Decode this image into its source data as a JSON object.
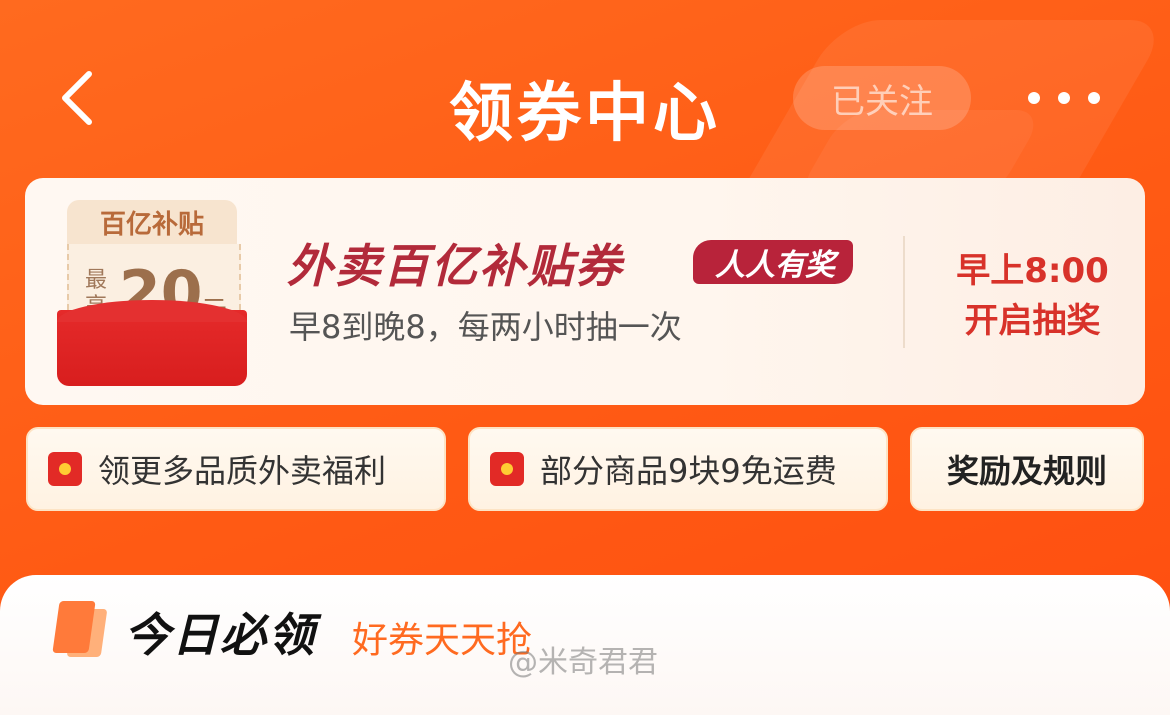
{
  "header": {
    "title": "领券中心",
    "follow_label": "已关注"
  },
  "banner": {
    "coupon_top_label": "百亿补贴",
    "coupon_max_label": "最高",
    "coupon_amount": "20",
    "coupon_unit": "元",
    "title": "外卖百亿补贴券",
    "badge": "人人有奖",
    "subtitle": "早8到晚8，每两小时抽一次",
    "time_line1": "早上8:00",
    "time_line2": "开启抽奖"
  },
  "quick_links": [
    {
      "label": "领更多品质外卖福利"
    },
    {
      "label": "部分商品9块9免运费"
    },
    {
      "label": "奖励及规则"
    }
  ],
  "section": {
    "title": "今日必领",
    "subtitle": "好券天天抢",
    "watermark": "@米奇君君"
  },
  "colors": {
    "background": "#ff5a14",
    "banner_title": "#b22a3a",
    "time_accent": "#d8322a",
    "section_accent": "#ff6a20"
  }
}
